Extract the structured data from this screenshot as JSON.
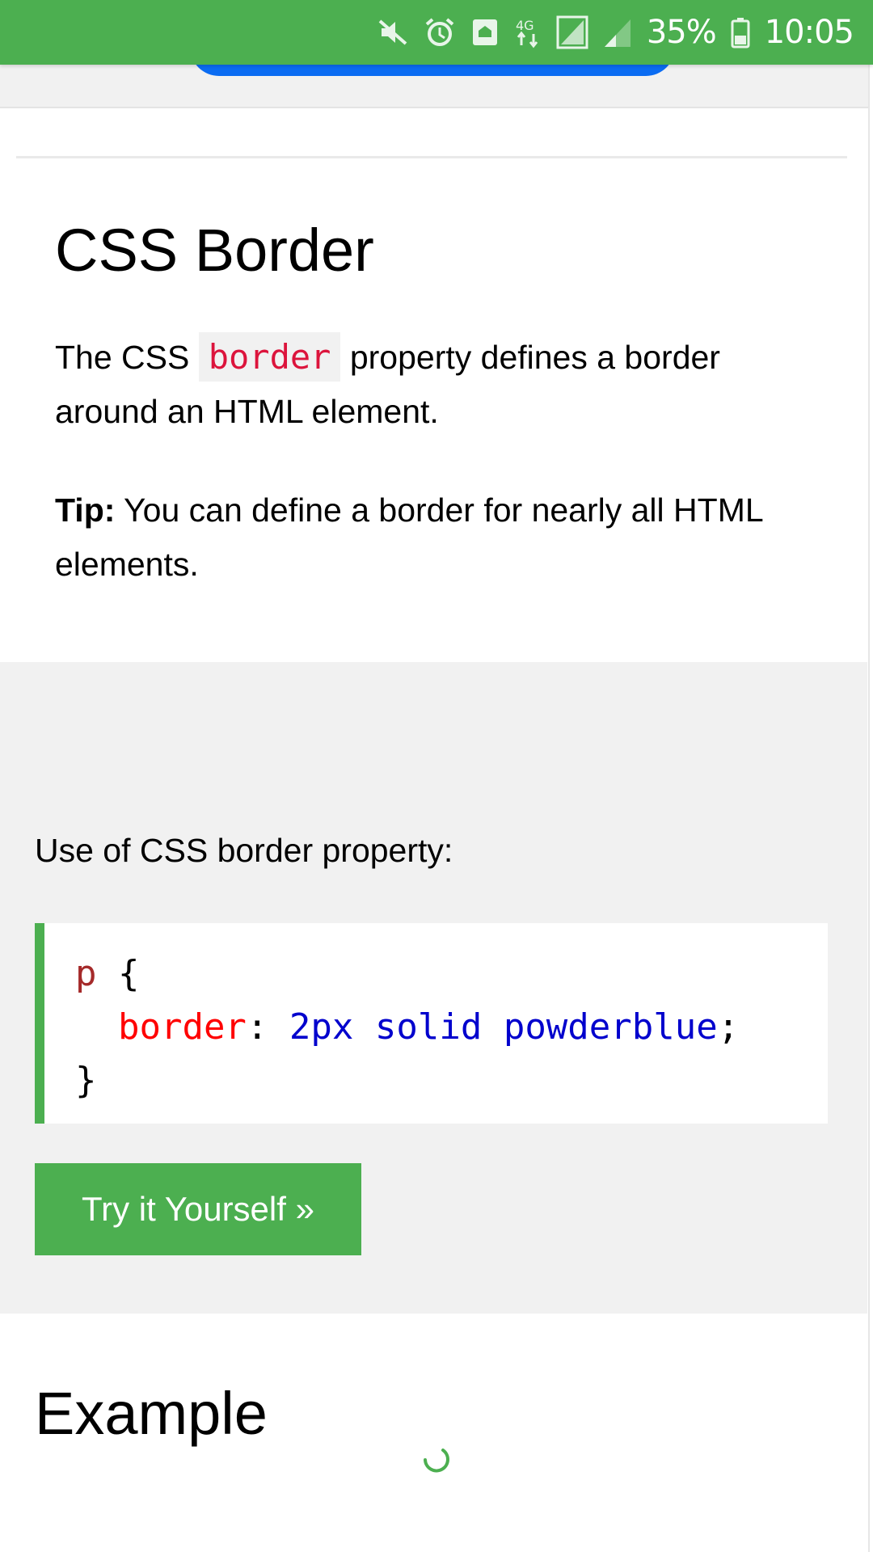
{
  "status_bar": {
    "battery_percent": "35%",
    "time": "10:05",
    "network_label": "4G",
    "icons": [
      "mute-icon",
      "alarm-icon",
      "home-icon",
      "network-4g-icon",
      "signal-icon",
      "signal-weak-icon",
      "battery-icon"
    ],
    "color": "#4caf50"
  },
  "section": {
    "title": "CSS Border",
    "intro_before": "The CSS ",
    "intro_code": "border",
    "intro_after": " property defines a border around an HTML element.",
    "tip_label": "Tip:",
    "tip_text": " You can define a border for nearly all HTML elements."
  },
  "example": {
    "title": "Example",
    "description": "Use of CSS border property:",
    "code": {
      "selector": "p",
      "open_brace": " {",
      "indent": "  ",
      "property": "border",
      "colon": ": ",
      "value": "2px solid powderblue",
      "semicolon": ";",
      "close_brace": "}"
    },
    "try_button_label": "Try it Yourself »",
    "accent_color": "#4caf50"
  },
  "loading": {
    "icon": "loading-spinner-icon"
  }
}
